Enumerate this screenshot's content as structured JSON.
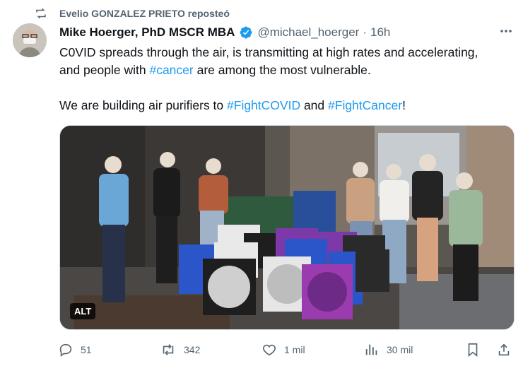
{
  "repost": {
    "label": "Evelio GONZALEZ PRIETO reposteó"
  },
  "author": {
    "name": "Mike Hoerger, PhD MSCR MBA",
    "handle": "@michael_hoerger",
    "separator": "·",
    "time": "16h"
  },
  "tweet": {
    "line1_prefix": "C0VID spreads through the air, is transmitting at high rates and accelerating,",
    "line2_prefix": "and people with ",
    "hashtag_cancer": "#cancer",
    "line2_suffix": " are among the most vulnerable.",
    "p2_prefix": "We are building air purifiers to ",
    "hashtag_fightcovid": "#FightCOVID",
    "p2_mid": " and ",
    "hashtag_fightcancer": "#FightCancer",
    "p2_suffix": "!"
  },
  "media": {
    "alt_badge": "ALT"
  },
  "actions": {
    "replies": "51",
    "reposts": "342",
    "likes": "1 mil",
    "views": "30 mil"
  },
  "colors": {
    "accent": "#1d9bf0",
    "muted": "#536471",
    "text": "#0f1419"
  }
}
